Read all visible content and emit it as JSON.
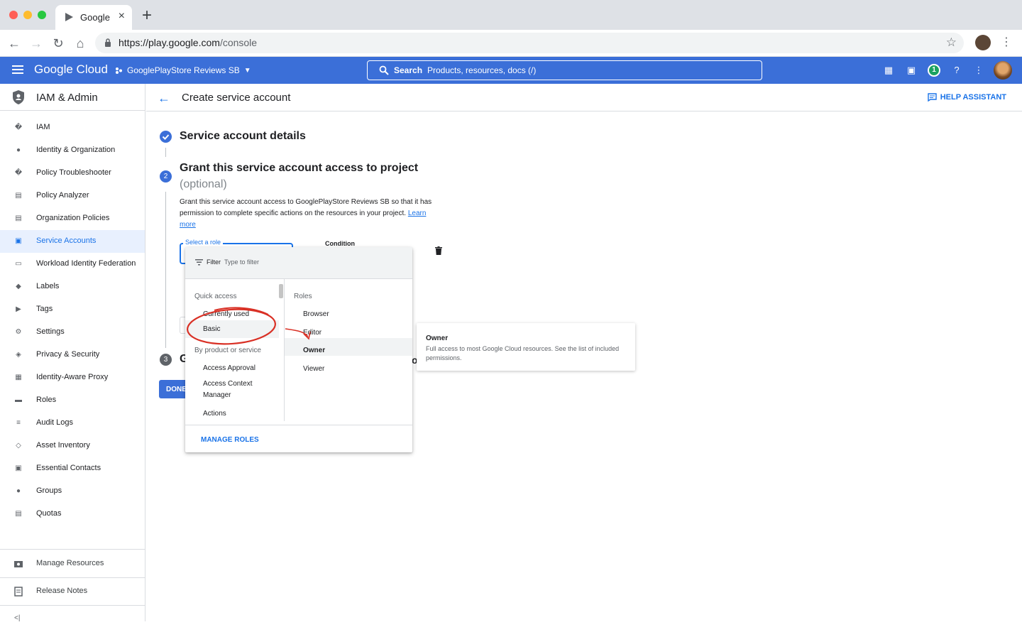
{
  "browser": {
    "tab_title": "Google",
    "url_host": "https://play.google.com",
    "url_path": "/console"
  },
  "header": {
    "logo": "Google Cloud",
    "project": "GooglePlayStore Reviews SB",
    "search_label": "Search",
    "search_placeholder": "Products, resources, docs (/)",
    "notification_count": "1"
  },
  "sidebar": {
    "title": "IAM & Admin",
    "items": [
      {
        "label": "IAM",
        "icon": "add-person-icon"
      },
      {
        "label": "Identity & Organization",
        "icon": "account-circle-icon"
      },
      {
        "label": "Policy Troubleshooter",
        "icon": "wrench-icon"
      },
      {
        "label": "Policy Analyzer",
        "icon": "document-search-icon"
      },
      {
        "label": "Organization Policies",
        "icon": "list-doc-icon"
      },
      {
        "label": "Service Accounts",
        "icon": "service-account-icon"
      },
      {
        "label": "Workload Identity Federation",
        "icon": "id-card-icon"
      },
      {
        "label": "Labels",
        "icon": "label-icon"
      },
      {
        "label": "Tags",
        "icon": "tag-arrow-icon"
      },
      {
        "label": "Settings",
        "icon": "gear-icon"
      },
      {
        "label": "Privacy & Security",
        "icon": "shield-icon"
      },
      {
        "label": "Identity-Aware Proxy",
        "icon": "proxy-icon"
      },
      {
        "label": "Roles",
        "icon": "hat-icon"
      },
      {
        "label": "Audit Logs",
        "icon": "lines-icon"
      },
      {
        "label": "Asset Inventory",
        "icon": "diamond-icon"
      },
      {
        "label": "Essential Contacts",
        "icon": "contact-icon"
      },
      {
        "label": "Groups",
        "icon": "group-icon"
      },
      {
        "label": "Quotas",
        "icon": "quota-icon"
      }
    ],
    "footer_items": [
      {
        "label": "Manage Resources",
        "icon": "folder-gear-icon"
      },
      {
        "label": "Release Notes",
        "icon": "notes-icon"
      }
    ],
    "collapse_glyph": "<|"
  },
  "main": {
    "page_title": "Create service account",
    "help_assistant": "HELP ASSISTANT",
    "step1_title": "Service account details",
    "step2_number": "2",
    "step2_title": "Grant this service account access to project",
    "step2_subtitle": "(optional)",
    "step2_desc": "Grant this service account access to GooglePlayStore Reviews SB so that it has permission to complete specific actions on the resources in your project.",
    "step2_link": "Learn more",
    "role_label": "Select a role",
    "condition_label": "Condition",
    "step3_number": "3",
    "step3_title": "G",
    "step3_tail": "ot",
    "done_label": "DONE"
  },
  "dropdown": {
    "filter_label": "Filter",
    "filter_placeholder": "Type to filter",
    "quick_access_head": "Quick access",
    "quick_items": [
      "Currently used",
      "Basic"
    ],
    "by_product_head": "By product or service",
    "product_items": [
      "Access Approval",
      "Access Context Manager",
      "Actions"
    ],
    "roles_head": "Roles",
    "roles": [
      "Browser",
      "Editor",
      "Owner",
      "Viewer"
    ],
    "selected_role": "Owner",
    "manage_roles": "MANAGE ROLES"
  },
  "tooltip": {
    "title": "Owner",
    "desc": "Full access to most Google Cloud resources. See the list of included permissions."
  },
  "colors": {
    "gcp_blue": "#3b6fd8",
    "link_blue": "#1a73e8",
    "annotation_red": "#d93025"
  }
}
